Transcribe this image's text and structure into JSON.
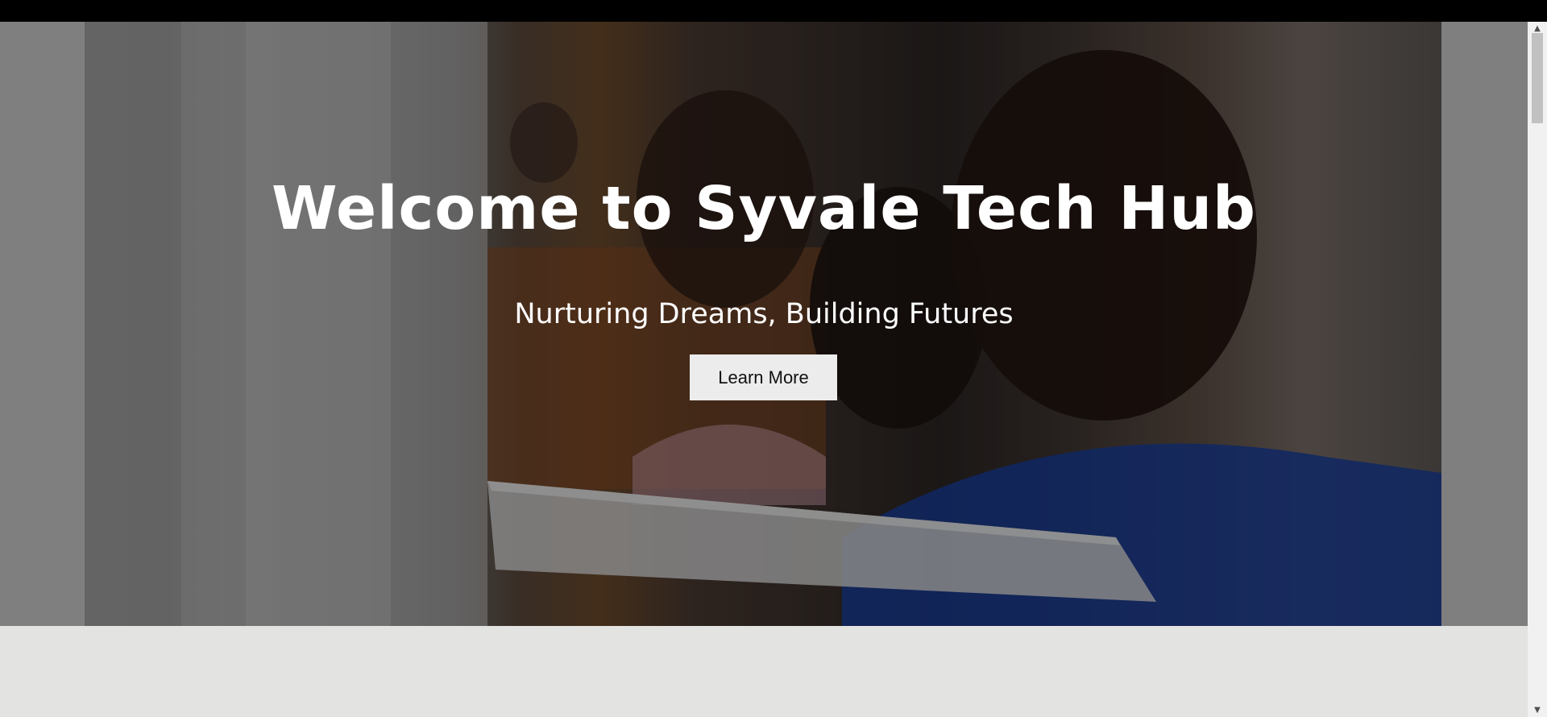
{
  "hero": {
    "title": "Welcome to Syvale Tech Hub",
    "subtitle": "Nurturing Dreams, Building Futures",
    "button_label": "Learn More",
    "image_description_icon": "hero-photo"
  },
  "scrollbar": {
    "up_glyph": "▲",
    "down_glyph": "▼"
  },
  "colors": {
    "page_background": "#e3e3e1",
    "hero_band": "#7f7f7f",
    "top_bar": "#000000",
    "button_background": "#ececec",
    "text_on_hero": "#ffffff"
  }
}
